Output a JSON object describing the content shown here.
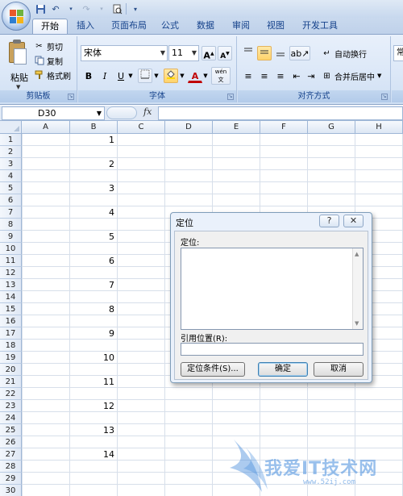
{
  "quick_access": {
    "icons": [
      "save-icon",
      "undo-icon",
      "redo-icon",
      "print-preview-icon",
      "customize-icon"
    ]
  },
  "tabs": [
    {
      "label": "开始",
      "active": true
    },
    {
      "label": "插入",
      "active": false
    },
    {
      "label": "页面布局",
      "active": false
    },
    {
      "label": "公式",
      "active": false
    },
    {
      "label": "数据",
      "active": false
    },
    {
      "label": "审阅",
      "active": false
    },
    {
      "label": "视图",
      "active": false
    },
    {
      "label": "开发工具",
      "active": false
    }
  ],
  "ribbon": {
    "clipboard": {
      "paste": "粘贴",
      "cut": "剪切",
      "copy": "复制",
      "format_painter": "格式刷",
      "group_label": "剪贴板"
    },
    "font": {
      "font_name": "宋体",
      "font_size": "11",
      "grow": "A",
      "shrink": "A",
      "bold": "B",
      "italic": "I",
      "underline": "U",
      "font_color": "A",
      "phonetic": "wén",
      "group_label": "字体"
    },
    "alignment": {
      "wrap_text": "自动换行",
      "merge_center": "合并后居中",
      "group_label": "对齐方式"
    },
    "number": {
      "format_partial": "常"
    }
  },
  "formula_bar": {
    "name_box": "D30",
    "fx": "fx",
    "formula": ""
  },
  "sheet": {
    "columns": [
      "A",
      "B",
      "C",
      "D",
      "E",
      "F",
      "G",
      "H"
    ],
    "rows": [
      "1",
      "2",
      "3",
      "4",
      "5",
      "6",
      "7",
      "8",
      "9",
      "10",
      "11",
      "12",
      "13",
      "14",
      "15",
      "16",
      "17",
      "18",
      "19",
      "20",
      "21",
      "22",
      "23",
      "24",
      "25",
      "26",
      "27",
      "28",
      "29",
      "30"
    ],
    "b_values": [
      {
        "row": 1,
        "value": "1"
      },
      {
        "row": 3,
        "value": "2"
      },
      {
        "row": 5,
        "value": "3"
      },
      {
        "row": 7,
        "value": "4"
      },
      {
        "row": 9,
        "value": "5"
      },
      {
        "row": 11,
        "value": "6"
      },
      {
        "row": 13,
        "value": "7"
      },
      {
        "row": 15,
        "value": "8"
      },
      {
        "row": 17,
        "value": "9"
      },
      {
        "row": 19,
        "value": "10"
      },
      {
        "row": 21,
        "value": "11"
      },
      {
        "row": 23,
        "value": "12"
      },
      {
        "row": 25,
        "value": "13"
      },
      {
        "row": 27,
        "value": "14"
      }
    ]
  },
  "dialog": {
    "title": "定位",
    "help": "?",
    "close": "✕",
    "goto_label": "定位:",
    "reference_label": "引用位置(R):",
    "reference_value": "",
    "special_button": "定位条件(S)...",
    "ok_button": "确定",
    "cancel_button": "取消"
  },
  "watermark": {
    "text": "我爱IT技术网",
    "url": "www.52ij.com"
  },
  "colors": {
    "ribbon_text": "#15428b",
    "grid_line": "#d7dfea",
    "header_border": "#9eb6d6"
  }
}
